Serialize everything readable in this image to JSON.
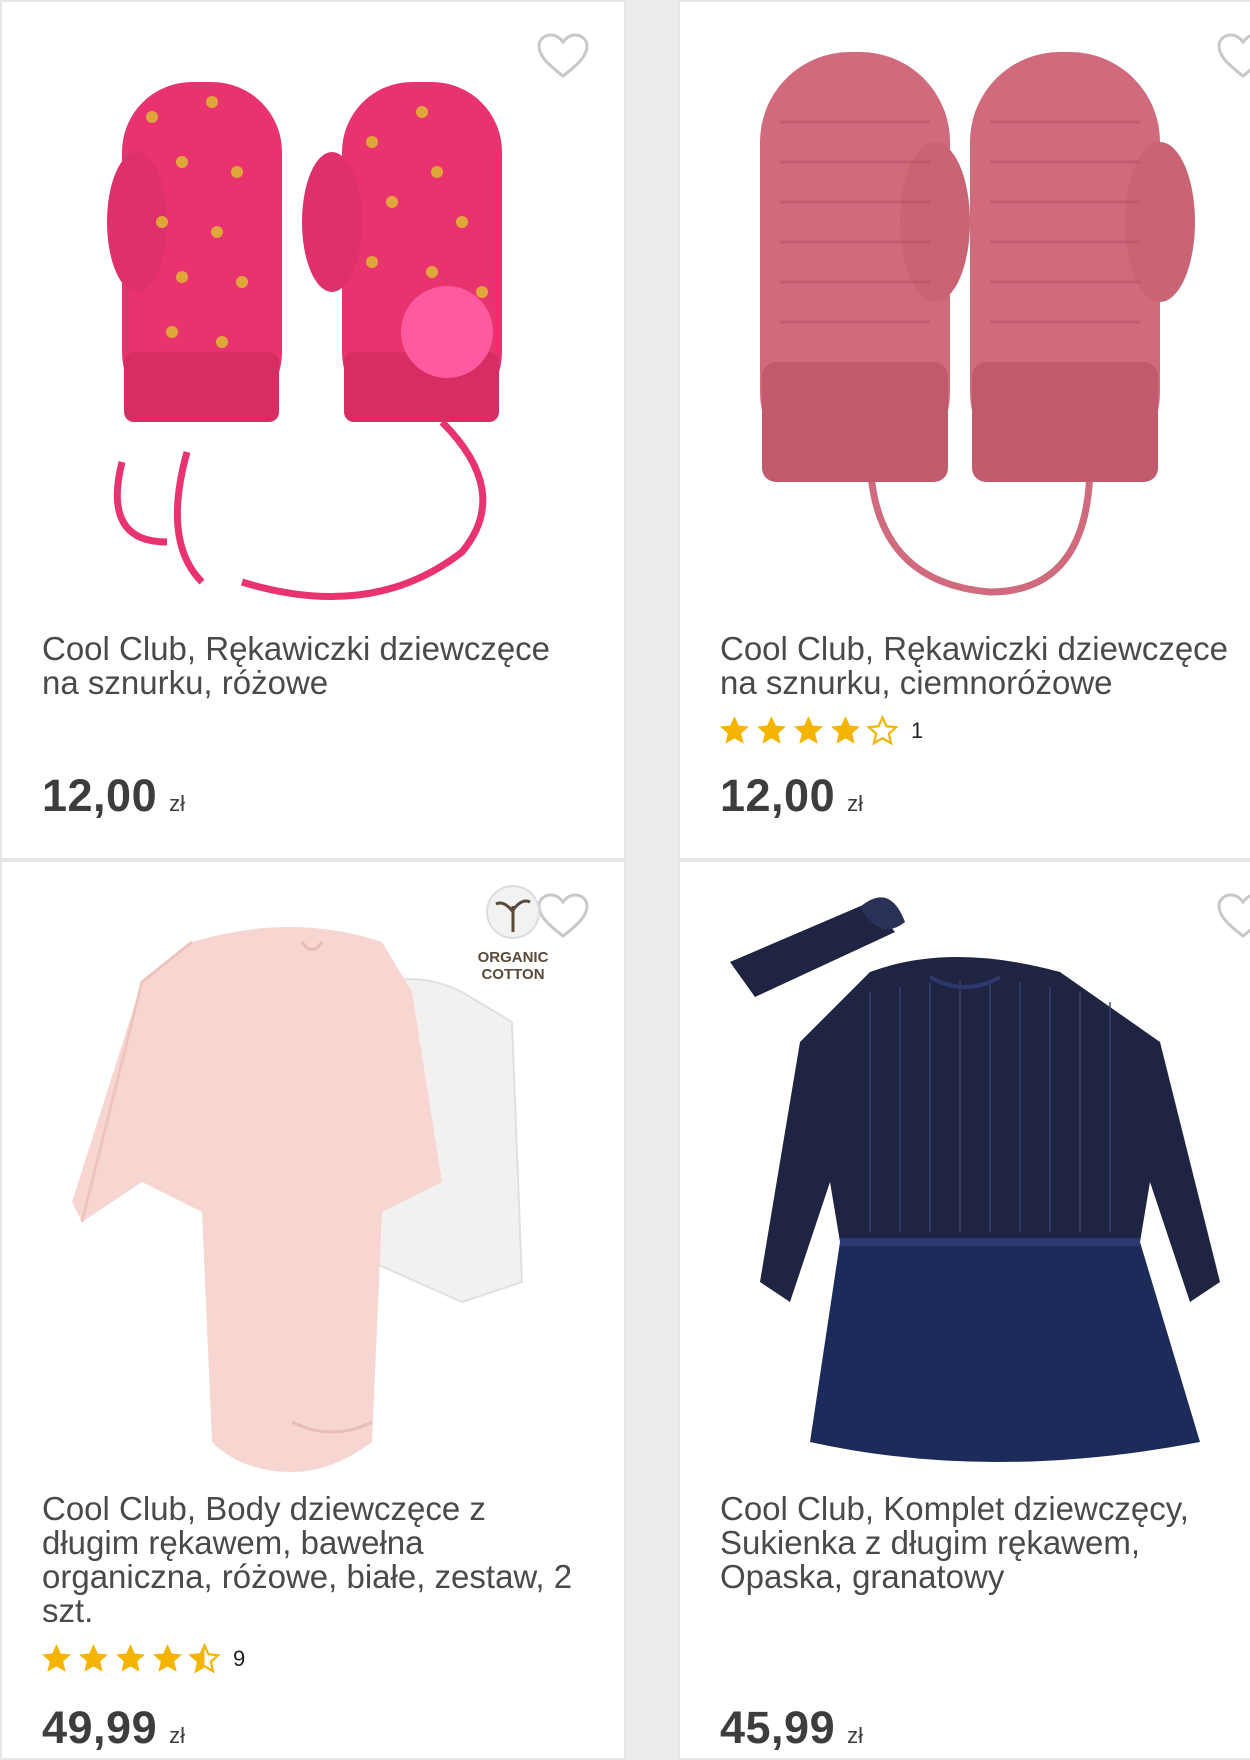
{
  "colors": {
    "star": "#f5b400",
    "mitten_pink": "#e8336f",
    "mitten_dusty": "#cf6b7d",
    "onesie_pink": "#f7d6d2",
    "dress_navy": "#1e2442",
    "heart_outline": "#c8c8c8"
  },
  "products": [
    {
      "title": "Cool Club, Rękawiczki dziewczęce na sznurku, różowe",
      "price": "12,00",
      "currency": "zł",
      "image": "pink-polka-dot-mittens"
    },
    {
      "title": "Cool Club, Rękawiczki dziewczęce na sznurku, ciemnoróżowe",
      "price": "12,00",
      "currency": "zł",
      "rating": 4,
      "reviews": "1",
      "image": "dusty-pink-knit-mittens"
    },
    {
      "title": "Cool Club, Body dziewczęce z długim rękawem, bawełna organiczna, różowe, białe, zestaw, 2 szt.",
      "price": "49,99",
      "currency": "zł",
      "rating": 4.5,
      "reviews": "9",
      "badge": [
        "ORGANIC",
        "COTTON"
      ],
      "image": "pink-white-bodysuit-set"
    },
    {
      "title": "Cool Club, Komplet dziewczęcy, Sukienka z długim rękawem, Opaska, granatowy",
      "price": "45,99",
      "currency": "zł",
      "image": "navy-velvet-dress-headband"
    }
  ],
  "icons": {
    "favorite": "heart-outline-icon",
    "star_full": "star-icon",
    "star_half": "star-half-icon",
    "star_empty": "star-outline-icon"
  }
}
